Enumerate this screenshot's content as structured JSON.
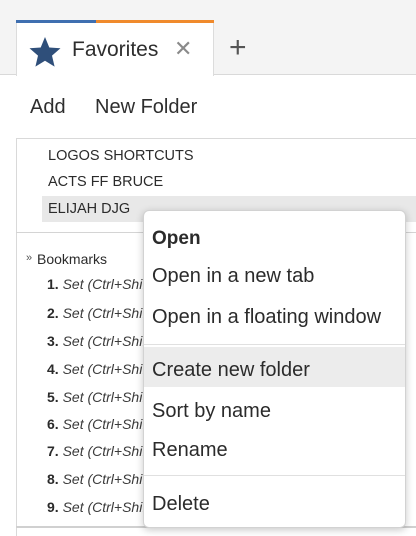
{
  "tab": {
    "title": "Favorites",
    "close_glyph": "✕",
    "add_glyph": "+",
    "icon": "star-icon",
    "accent_colors": [
      "#3f6fb0",
      "#f08a2c"
    ]
  },
  "toolbar": {
    "add_label": "Add",
    "new_folder_label": "New Folder"
  },
  "favorites": {
    "items": [
      "LOGOS SHORTCUTS",
      "ACTS FF BRUCE",
      "ELIJAH DJG"
    ],
    "selected_index": 2
  },
  "bookmarks": {
    "title": "Bookmarks",
    "chevron": "»",
    "items": [
      {
        "num": "1.",
        "text": "Set (Ctrl+Shift+1)"
      },
      {
        "num": "2.",
        "text": "Set (Ctrl+Shift+2)"
      },
      {
        "num": "3.",
        "text": "Set (Ctrl+Shift+3)"
      },
      {
        "num": "4.",
        "text": "Set (Ctrl+Shift+4)"
      },
      {
        "num": "5.",
        "text": "Set (Ctrl+Shift+5)"
      },
      {
        "num": "6.",
        "text": "Set (Ctrl+Shift+6)"
      },
      {
        "num": "7.",
        "text": "Set (Ctrl+Shift+7)"
      },
      {
        "num": "8.",
        "text": "Set (Ctrl+Shift+8)"
      },
      {
        "num": "9.",
        "text": "Set (Ctrl+Shift+9)"
      }
    ]
  },
  "context_menu": {
    "items": [
      {
        "label": "Open",
        "bold": true
      },
      {
        "label": "Open in a new tab"
      },
      {
        "label": "Open in a floating window"
      },
      {
        "label": "Create new folder",
        "hovered": true
      },
      {
        "label": "Sort by name"
      },
      {
        "label": "Rename"
      },
      {
        "label": "Delete"
      }
    ]
  }
}
